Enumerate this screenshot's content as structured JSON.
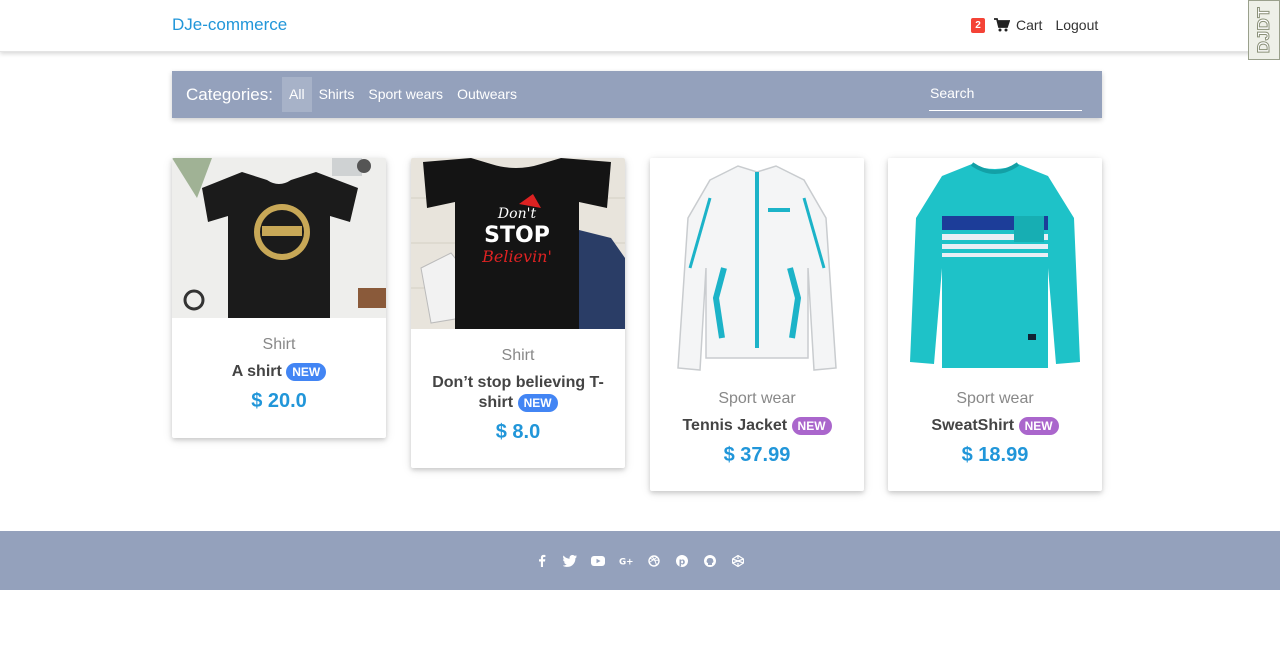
{
  "navbar": {
    "brand": "DJe-commerce",
    "cart_count": "2",
    "cart_label": "Cart",
    "logout_label": "Logout"
  },
  "djdt": {
    "label": "DJDT"
  },
  "categories": {
    "title": "Categories:",
    "items": [
      "All",
      "Shirts",
      "Sport wears",
      "Outwears"
    ],
    "active": "All",
    "search_placeholder": "Search"
  },
  "products": [
    {
      "category": "Shirt",
      "name": "A shirt",
      "badge": "NEW",
      "badge_color": "#4285f4",
      "price": "$ 20.0"
    },
    {
      "category": "Shirt",
      "name": "Don’t stop believing T-shirt",
      "badge": "NEW",
      "badge_color": "#4285f4",
      "price": "$ 8.0"
    },
    {
      "category": "Sport wear",
      "name": "Tennis Jacket",
      "badge": "NEW",
      "badge_color": "#aa66cc",
      "price": "$ 37.99"
    },
    {
      "category": "Sport wear",
      "name": "SweatShirt",
      "badge": "NEW",
      "badge_color": "#aa66cc",
      "price": "$ 18.99"
    }
  ],
  "footer": {
    "social_icons": [
      "facebook-icon",
      "twitter-icon",
      "youtube-icon",
      "google-plus-icon",
      "dribbble-icon",
      "pinterest-icon",
      "github-icon",
      "codepen-icon"
    ]
  },
  "colors": {
    "accent": "#2196d9",
    "bar": "#94a1bc",
    "badge_red": "#f44336"
  }
}
